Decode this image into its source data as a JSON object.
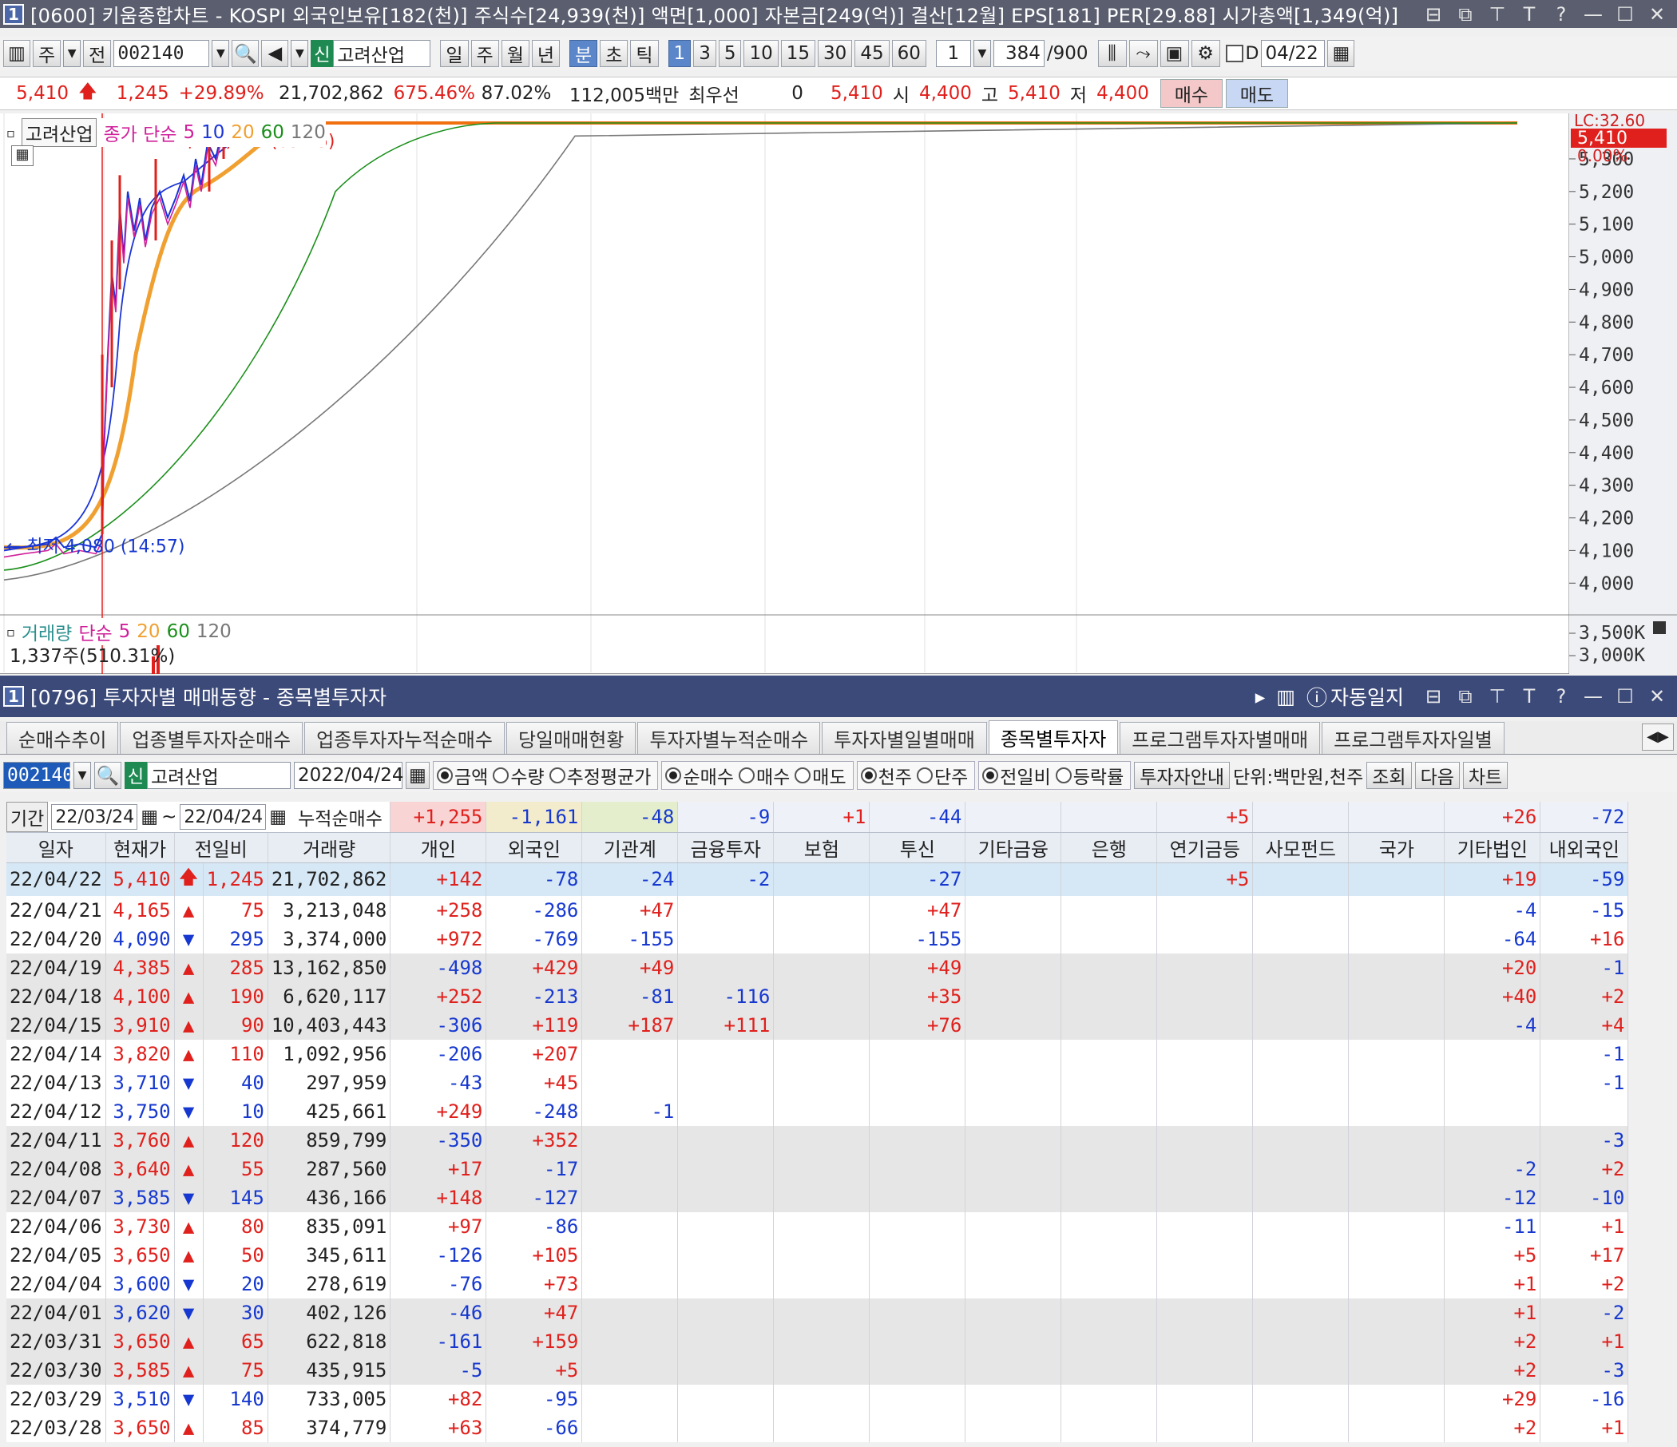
{
  "window1": {
    "num": "1",
    "title": "[0600] 키움종합차트 - KOSPI 외국인보유[182(천)] 주식수[24,939(천)] 액면[1,000] 자본금[249(억)] 결산[12월] EPS[181] PER[29.88] 시가총액[1,349(억)]",
    "controls": [
      "⊟",
      "⧉",
      "⊤",
      "T",
      "?",
      "—",
      "☐",
      "✕"
    ]
  },
  "toolbar": {
    "type_label": "주",
    "jeon_label": "전",
    "code": "002140",
    "sin": "신",
    "name": "고려산업",
    "periods": [
      "일",
      "주",
      "월",
      "년"
    ],
    "minute_units": [
      "분",
      "초",
      "틱"
    ],
    "intervals": [
      "1",
      "3",
      "5",
      "10",
      "15",
      "30",
      "45",
      "60"
    ],
    "count": "1",
    "range_value": "384",
    "range_total": "/900",
    "date_checkbox_label": "D",
    "date": "04/22"
  },
  "quote": {
    "price": "5,410",
    "change": "1,245",
    "rate": "+29.89%",
    "volume": "21,702,862",
    "vol_rate": "675.46%",
    "pct": "87.02%",
    "amount": "112,005백만",
    "best_label": "최우선",
    "best_value": "0",
    "best_price": "5,410",
    "open_label": "시",
    "open": "4,400",
    "high_label": "고",
    "high": "5,410",
    "low_label": "저",
    "low": "4,400",
    "buy": "매수",
    "sell": "매도"
  },
  "chart": {
    "legend_name": "고려산업",
    "legend_ma_label": "종가 단순",
    "ma": [
      {
        "p": "5",
        "color": "#d0209a"
      },
      {
        "p": "10",
        "color": "#1b34d6"
      },
      {
        "p": "20",
        "color": "#f0a030"
      },
      {
        "p": "60",
        "color": "#1a8f1a"
      },
      {
        "p": "120",
        "color": "#777777"
      }
    ],
    "high_annot": "최고 5,410 (09:15)",
    "low_annot": "최저 4,080 (14:57)",
    "y_ticks": [
      "5,300",
      "5,200",
      "5,100",
      "5,000",
      "4,900",
      "4,800",
      "4,700",
      "4,600",
      "4,500",
      "4,400",
      "4,300",
      "4,200",
      "4,100",
      "4,000"
    ],
    "y_top_label": "LC:32.60",
    "last_price_tag": "5,410",
    "pct_tag": "0.00%",
    "vol_legend_name": "거래량",
    "vol_ma_label": "단순",
    "vol_ma": [
      {
        "p": "5",
        "color": "#d0209a"
      },
      {
        "p": "20",
        "color": "#f0a030"
      },
      {
        "p": "60",
        "color": "#1a8f1a"
      },
      {
        "p": "120",
        "color": "#777777"
      }
    ],
    "vol_value": "1,337주(510.31%)",
    "vol_ticks": [
      "3,500K",
      "3,000K"
    ]
  },
  "window2": {
    "num": "1",
    "title": "[0796] 투자자별 매매동향 - 종목별투자자",
    "auto_log": "자동일지",
    "controls": [
      "⊟",
      "⧉",
      "⊤",
      "T",
      "?",
      "—",
      "☐",
      "✕"
    ]
  },
  "tabs": [
    "순매수추이",
    "업종별투자자순매수",
    "업종투자자누적순매수",
    "당일매매현황",
    "투자자별누적순매수",
    "투자자별일별매매",
    "종목별투자자",
    "프로그램투자자별매매",
    "프로그램투자자일별"
  ],
  "active_tab": 6,
  "filters": {
    "code": "002140",
    "sin": "신",
    "name": "고려산업",
    "date": "2022/04/24",
    "g1": [
      "금액",
      "수량",
      "추정평균가"
    ],
    "g2": [
      "순매수",
      "매수",
      "매도"
    ],
    "g3": [
      "천주",
      "단주"
    ],
    "g4": [
      "전일비",
      "등락률"
    ],
    "guide": "투자자안내",
    "unit": "단위:백만원,천주",
    "query": "조회",
    "next": "다음",
    "chart": "차트"
  },
  "period": {
    "label": "기간",
    "from": "22/03/24",
    "to": "22/04/24",
    "cum_label": "누적순매수"
  },
  "summary": [
    "+1,255",
    "-1,161",
    "-48",
    "-9",
    "+1",
    "-44",
    "",
    "",
    "+5",
    "",
    "",
    "+26",
    "-72"
  ],
  "headers": [
    "일자",
    "현재가",
    "전일비",
    "거래량",
    "개인",
    "외국인",
    "기관계",
    "금융투자",
    "보험",
    "투신",
    "기타금융",
    "은행",
    "연기금등",
    "사모펀드",
    "국가",
    "기타법인",
    "내외국인"
  ],
  "rows": [
    [
      "22/04/22",
      "5,410",
      "up2",
      "1,245",
      "21,702,862",
      "+142",
      "-78",
      "-24",
      "-2",
      "",
      "-27",
      "",
      "",
      "+5",
      "",
      "",
      "+19",
      "-59"
    ],
    [
      "22/04/21",
      "4,165",
      "up",
      "75",
      "3,213,048",
      "+258",
      "-286",
      "+47",
      "",
      "",
      "+47",
      "",
      "",
      "",
      "",
      "",
      "-4",
      "-15"
    ],
    [
      "22/04/20",
      "4,090",
      "dn",
      "295",
      "3,374,000",
      "+972",
      "-769",
      "-155",
      "",
      "",
      "-155",
      "",
      "",
      "",
      "",
      "",
      "-64",
      "+16"
    ],
    [
      "22/04/19",
      "4,385",
      "up",
      "285",
      "13,162,850",
      "-498",
      "+429",
      "+49",
      "",
      "",
      "+49",
      "",
      "",
      "",
      "",
      "",
      "+20",
      "-1"
    ],
    [
      "22/04/18",
      "4,100",
      "up",
      "190",
      "6,620,117",
      "+252",
      "-213",
      "-81",
      "-116",
      "",
      "+35",
      "",
      "",
      "",
      "",
      "",
      "+40",
      "+2"
    ],
    [
      "22/04/15",
      "3,910",
      "up",
      "90",
      "10,403,443",
      "-306",
      "+119",
      "+187",
      "+111",
      "",
      "+76",
      "",
      "",
      "",
      "",
      "",
      "-4",
      "+4"
    ],
    [
      "22/04/14",
      "3,820",
      "up",
      "110",
      "1,092,956",
      "-206",
      "+207",
      "",
      "",
      "",
      "",
      "",
      "",
      "",
      "",
      "",
      "",
      "-1"
    ],
    [
      "22/04/13",
      "3,710",
      "dn",
      "40",
      "297,959",
      "-43",
      "+45",
      "",
      "",
      "",
      "",
      "",
      "",
      "",
      "",
      "",
      "",
      "-1"
    ],
    [
      "22/04/12",
      "3,750",
      "dn",
      "10",
      "425,661",
      "+249",
      "-248",
      "-1",
      "",
      "",
      "",
      "",
      "",
      "",
      "",
      "",
      "",
      ""
    ],
    [
      "22/04/11",
      "3,760",
      "up",
      "120",
      "859,799",
      "-350",
      "+352",
      "",
      "",
      "",
      "",
      "",
      "",
      "",
      "",
      "",
      "",
      "-3"
    ],
    [
      "22/04/08",
      "3,640",
      "up",
      "55",
      "287,560",
      "+17",
      "-17",
      "",
      "",
      "",
      "",
      "",
      "",
      "",
      "",
      "",
      "-2",
      "+2"
    ],
    [
      "22/04/07",
      "3,585",
      "dn",
      "145",
      "436,166",
      "+148",
      "-127",
      "",
      "",
      "",
      "",
      "",
      "",
      "",
      "",
      "",
      "-12",
      "-10"
    ],
    [
      "22/04/06",
      "3,730",
      "up",
      "80",
      "835,091",
      "+97",
      "-86",
      "",
      "",
      "",
      "",
      "",
      "",
      "",
      "",
      "",
      "-11",
      "+1"
    ],
    [
      "22/04/05",
      "3,650",
      "up",
      "50",
      "345,611",
      "-126",
      "+105",
      "",
      "",
      "",
      "",
      "",
      "",
      "",
      "",
      "",
      "+5",
      "+17"
    ],
    [
      "22/04/04",
      "3,600",
      "dn",
      "20",
      "278,619",
      "-76",
      "+73",
      "",
      "",
      "",
      "",
      "",
      "",
      "",
      "",
      "",
      "+1",
      "+2"
    ],
    [
      "22/04/01",
      "3,620",
      "dn",
      "30",
      "402,126",
      "-46",
      "+47",
      "",
      "",
      "",
      "",
      "",
      "",
      "",
      "",
      "",
      "+1",
      "-2"
    ],
    [
      "22/03/31",
      "3,650",
      "up",
      "65",
      "622,818",
      "-161",
      "+159",
      "",
      "",
      "",
      "",
      "",
      "",
      "",
      "",
      "",
      "+2",
      "+1"
    ],
    [
      "22/03/30",
      "3,585",
      "up",
      "75",
      "435,915",
      "-5",
      "+5",
      "",
      "",
      "",
      "",
      "",
      "",
      "",
      "",
      "",
      "+2",
      "-3"
    ],
    [
      "22/03/29",
      "3,510",
      "dn",
      "140",
      "733,005",
      "+82",
      "-95",
      "",
      "",
      "",
      "",
      "",
      "",
      "",
      "",
      "",
      "+29",
      "-16"
    ],
    [
      "22/03/28",
      "3,650",
      "up",
      "85",
      "374,779",
      "+63",
      "-66",
      "",
      "",
      "",
      "",
      "",
      "",
      "",
      "",
      "",
      "+2",
      "+1"
    ]
  ]
}
